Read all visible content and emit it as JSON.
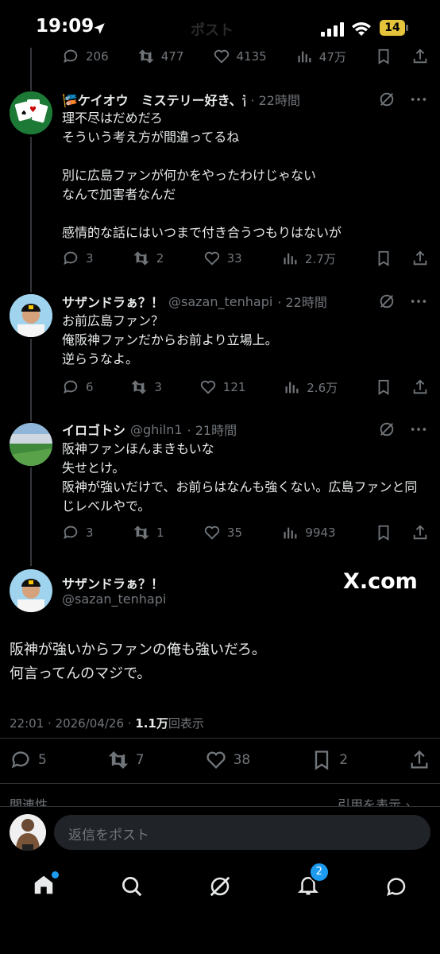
{
  "status": {
    "time": "19:09",
    "battery": "14"
  },
  "header_title": "ポスト",
  "prev_actions": {
    "replies": "206",
    "reposts": "477",
    "likes": "4135",
    "views": "47万"
  },
  "tweets": [
    {
      "display_name": "🎏ケイオウ　ミステリー好き、音楽…",
      "time": "22時間",
      "text": "理不尽はだめだろ\nそういう考え方が間違ってるね\n\n別に広島ファンが何かをやったわけじゃない\nなんで加害者なんだ\n\n感情的な話にはいつまで付き合うつもりはないが",
      "replies": "3",
      "reposts": "2",
      "likes": "33",
      "views": "2.7万"
    },
    {
      "display_name": "サザンドラぁ？！",
      "handle": "@sazan_tenhapi",
      "time": "22時間",
      "text": "お前広島ファン？\n俺阪神ファンだからお前より立場上。\n逆らうなよ。",
      "replies": "6",
      "reposts": "3",
      "likes": "121",
      "views": "2.6万"
    },
    {
      "display_name": "イロゴトシ",
      "handle": "@ghiln1",
      "time": "21時間",
      "text": "阪神ファンほんまきもいな\n失せとけ。\n阪神が強いだけで、お前らはなんも強くない。広島ファンと同じレベルやで。",
      "replies": "3",
      "reposts": "1",
      "likes": "35",
      "views": "9943"
    }
  ],
  "main_tweet": {
    "display_name": "サザンドラぁ？！",
    "handle": "@sazan_tenhapi",
    "watermark": "X.com",
    "text": "阪神が強いからファンの俺も強いだろ。\n何言ってんのマジで。",
    "timestamp": "22:01 · 2026/04/26 · ",
    "views_count": "1.1万",
    "views_label": "回表示",
    "replies": "5",
    "reposts": "7",
    "likes": "38",
    "bookmarks": "2"
  },
  "relevance_label": "関連性",
  "quote_label": "引用を表示",
  "reply_placeholder": "返信をポスト",
  "notification_badge": "2",
  "colors": {
    "accent": "#1d9bf0",
    "muted": "#71767b",
    "bg": "#000000"
  }
}
